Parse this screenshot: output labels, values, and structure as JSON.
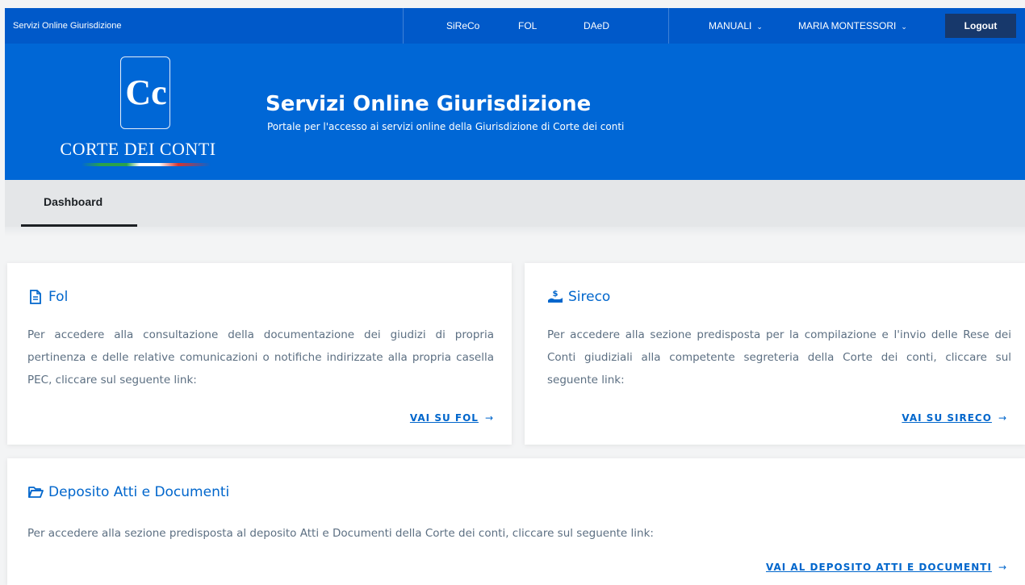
{
  "topbar": {
    "brand": "Servizi Online Giurisdizione",
    "links": [
      "SiReCo",
      "FOL",
      "DAeD"
    ],
    "manuali": "MANUALI",
    "user": "MARIA MONTESSORI",
    "logout": "Logout"
  },
  "header": {
    "logo_monogram": "Cc",
    "logo_name": "CORTE DEI CONTI",
    "title": "Servizi Online Giurisdizione",
    "subtitle": "Portale per l'accesso ai servizi online della Giurisdizione di Corte dei conti"
  },
  "tabs": {
    "dashboard": "Dashboard"
  },
  "cards": {
    "fol": {
      "icon": "document-icon",
      "title": "Fol",
      "text": "Per accedere alla consultazione della documentazione dei giudizi di propria pertinenza e delle relative comunicazioni o notifiche indirizzate alla propria casella PEC, cliccare sul seguente link:",
      "link": "VAI SU FOL"
    },
    "sireco": {
      "icon": "hand-money-icon",
      "title": "Sireco",
      "text": "Per accedere alla sezione predisposta per la compilazione e l'invio delle Rese dei Conti giudiziali alla competente segreteria della Corte dei conti, cliccare sul seguente link:",
      "link": "VAI SU SIRECO"
    },
    "deposito": {
      "icon": "folder-open-icon",
      "title": "Deposito Atti e Documenti",
      "text": "Per accedere alla sezione predisposta al deposito Atti e Documenti della Corte dei conti, cliccare sul seguente link:",
      "link": "VAI AL DEPOSITO ATTI E DOCUMENTI"
    }
  },
  "colors": {
    "topbar": "#0059c9",
    "header": "#0067d6",
    "accent": "#0066cc",
    "logout_bg": "#17386b",
    "text_muted": "#5c6f82"
  }
}
